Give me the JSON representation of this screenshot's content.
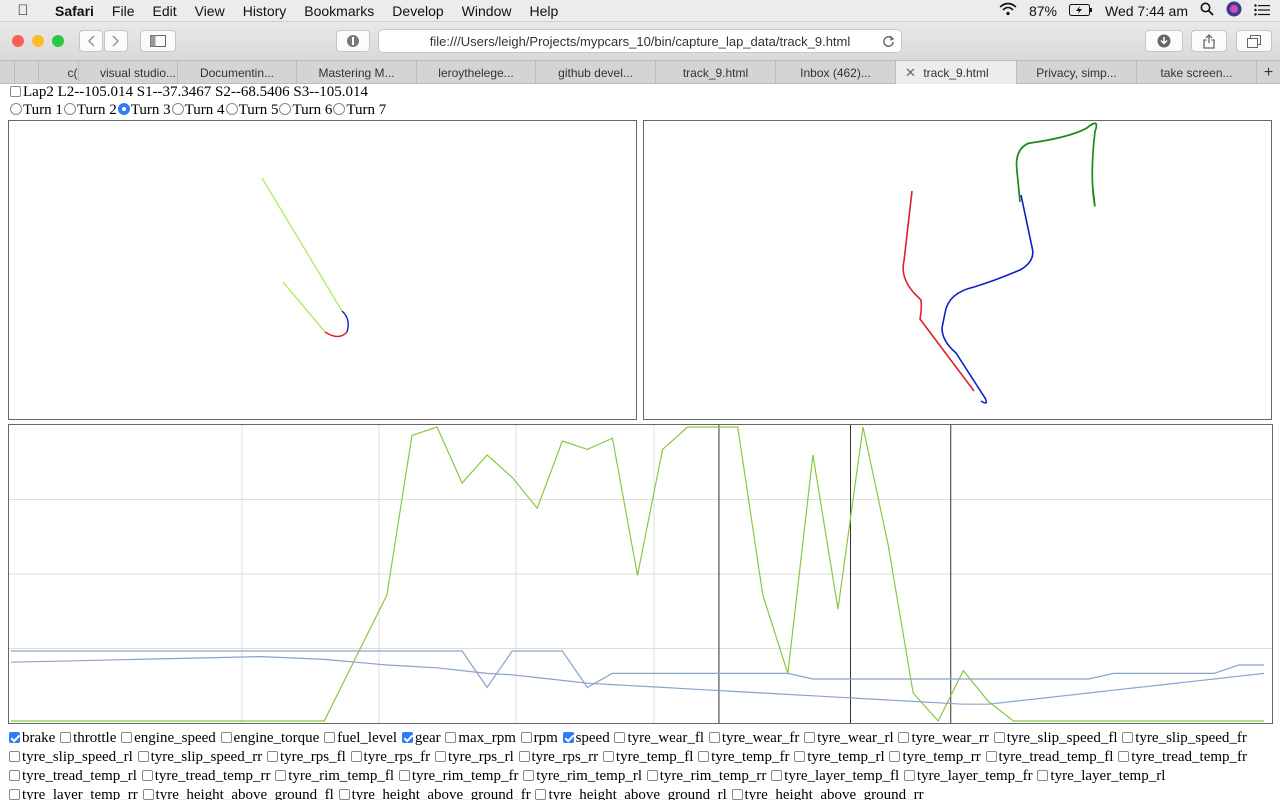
{
  "menubar": {
    "app": "Safari",
    "items": [
      "File",
      "Edit",
      "View",
      "History",
      "Bookmarks",
      "Develop",
      "Window",
      "Help"
    ],
    "battery": "87%",
    "clock": "Wed 7:44 am"
  },
  "toolbar": {
    "url": "file:///Users/leigh/Projects/mypcars_10/bin/capture_lap_data/track_9.html"
  },
  "tabs": [
    {
      "label": "c("
    },
    {
      "label": "visual studio..."
    },
    {
      "label": "Documentin..."
    },
    {
      "label": "Mastering M..."
    },
    {
      "label": "leroythelege..."
    },
    {
      "label": "github devel..."
    },
    {
      "label": "track_9.html"
    },
    {
      "label": "Inbox (462)..."
    },
    {
      "label": "track_9.html",
      "active": true
    },
    {
      "label": "Privacy, simp..."
    },
    {
      "label": "take screen..."
    }
  ],
  "lap": {
    "label": "Lap2 L2--105.014 S1--37.3467 S2--68.5406 S3--105.014",
    "checked": false
  },
  "turns": [
    {
      "label": "Turn 1",
      "selected": false
    },
    {
      "label": "Turn 2",
      "selected": false
    },
    {
      "label": "Turn 3",
      "selected": true
    },
    {
      "label": "Turn 4",
      "selected": false
    },
    {
      "label": "Turn 5",
      "selected": false
    },
    {
      "label": "Turn 6",
      "selected": false
    },
    {
      "label": "Turn 7",
      "selected": false
    }
  ],
  "colors": {
    "sector1": "#e0202a",
    "sector2": "#1020c8",
    "sector3": "#1a8a1a",
    "speed_line": "#86c846",
    "gear_line": "#8aa4c8",
    "turn_seg": "#b2ee66"
  },
  "channels": [
    {
      "label": "brake",
      "checked": true
    },
    {
      "label": "throttle",
      "checked": false
    },
    {
      "label": "engine_speed",
      "checked": false
    },
    {
      "label": "engine_torque",
      "checked": false
    },
    {
      "label": "fuel_level",
      "checked": false
    },
    {
      "label": "gear",
      "checked": true
    },
    {
      "label": "max_rpm",
      "checked": false
    },
    {
      "label": "rpm",
      "checked": false
    },
    {
      "label": "speed",
      "checked": true
    },
    {
      "label": "tyre_wear_fl",
      "checked": false
    },
    {
      "label": "tyre_wear_fr",
      "checked": false
    },
    {
      "label": "tyre_wear_rl",
      "checked": false
    },
    {
      "label": "tyre_wear_rr",
      "checked": false
    },
    {
      "label": "tyre_slip_speed_fl",
      "checked": false
    },
    {
      "label": "tyre_slip_speed_fr",
      "checked": false
    },
    {
      "label": "tyre_slip_speed_rl",
      "checked": false
    },
    {
      "label": "tyre_slip_speed_rr",
      "checked": false
    },
    {
      "label": "tyre_rps_fl",
      "checked": false
    },
    {
      "label": "tyre_rps_fr",
      "checked": false
    },
    {
      "label": "tyre_rps_rl",
      "checked": false
    },
    {
      "label": "tyre_rps_rr",
      "checked": false
    },
    {
      "label": "tyre_temp_fl",
      "checked": false
    },
    {
      "label": "tyre_temp_fr",
      "checked": false
    },
    {
      "label": "tyre_temp_rl",
      "checked": false
    },
    {
      "label": "tyre_temp_rr",
      "checked": false
    },
    {
      "label": "tyre_tread_temp_fl",
      "checked": false
    },
    {
      "label": "tyre_tread_temp_fr",
      "checked": false
    },
    {
      "label": "tyre_tread_temp_rl",
      "checked": false
    },
    {
      "label": "tyre_tread_temp_rr",
      "checked": false
    },
    {
      "label": "tyre_rim_temp_fl",
      "checked": false
    },
    {
      "label": "tyre_rim_temp_fr",
      "checked": false
    },
    {
      "label": "tyre_rim_temp_rl",
      "checked": false
    },
    {
      "label": "tyre_rim_temp_rr",
      "checked": false
    },
    {
      "label": "tyre_layer_temp_fl",
      "checked": false
    },
    {
      "label": "tyre_layer_temp_fr",
      "checked": false
    },
    {
      "label": "tyre_layer_temp_rl",
      "checked": false
    },
    {
      "label": "tyre_layer_temp_rr",
      "checked": false
    },
    {
      "label": "tyre_height_above_ground_fl",
      "checked": false
    },
    {
      "label": "tyre_height_above_ground_fr",
      "checked": false
    },
    {
      "label": "tyre_height_above_ground_rl",
      "checked": false
    },
    {
      "label": "tyre_height_above_ground_rr",
      "checked": false
    }
  ],
  "chart_data": {
    "type": "line",
    "title": "",
    "xlabel": "",
    "ylabel": "",
    "grid": true,
    "x": [
      0,
      5,
      10,
      15,
      20,
      25,
      30,
      32,
      34,
      36,
      38,
      40,
      42,
      44,
      46,
      48,
      50,
      52,
      54,
      56,
      58,
      60,
      62,
      64,
      66,
      68,
      70,
      72,
      74,
      76,
      78,
      80,
      82,
      84,
      86,
      88,
      90,
      92,
      94,
      96,
      98,
      100
    ],
    "series": [
      {
        "name": "speed",
        "values": [
          -5,
          -5,
          -5,
          -5,
          -5,
          -5,
          40,
          97,
          100,
          80,
          90,
          82,
          71,
          95,
          92,
          96,
          47,
          92,
          100,
          100,
          100,
          40,
          12,
          90,
          35,
          100,
          58,
          5,
          -5,
          13,
          2,
          -5,
          -5,
          -5,
          -5,
          -5,
          -5,
          -5,
          -5,
          -5,
          -5,
          -5
        ]
      },
      {
        "name": "gear",
        "values": [
          20,
          20,
          20,
          20,
          20,
          20,
          20,
          20,
          20,
          20,
          7,
          20,
          20,
          20,
          7,
          12,
          12,
          12,
          12,
          12,
          12,
          12,
          12,
          10,
          10,
          10,
          10,
          10,
          10,
          10,
          10,
          10,
          10,
          10,
          10,
          12,
          12,
          12,
          12,
          12,
          15,
          15
        ]
      },
      {
        "name": "brake",
        "values": [
          16,
          16.5,
          17,
          17.5,
          18,
          17,
          15,
          14.5,
          14,
          13,
          12,
          11.5,
          10.5,
          9.5,
          8.5,
          8,
          7.5,
          7,
          6.5,
          6,
          5.5,
          5,
          4.5,
          4,
          3.5,
          3,
          2.5,
          2,
          1.5,
          1,
          1,
          2,
          3,
          4,
          5,
          6,
          7,
          8,
          9,
          10,
          11,
          12
        ]
      }
    ],
    "vertical_markers": [
      56.5,
      67,
      75
    ]
  }
}
